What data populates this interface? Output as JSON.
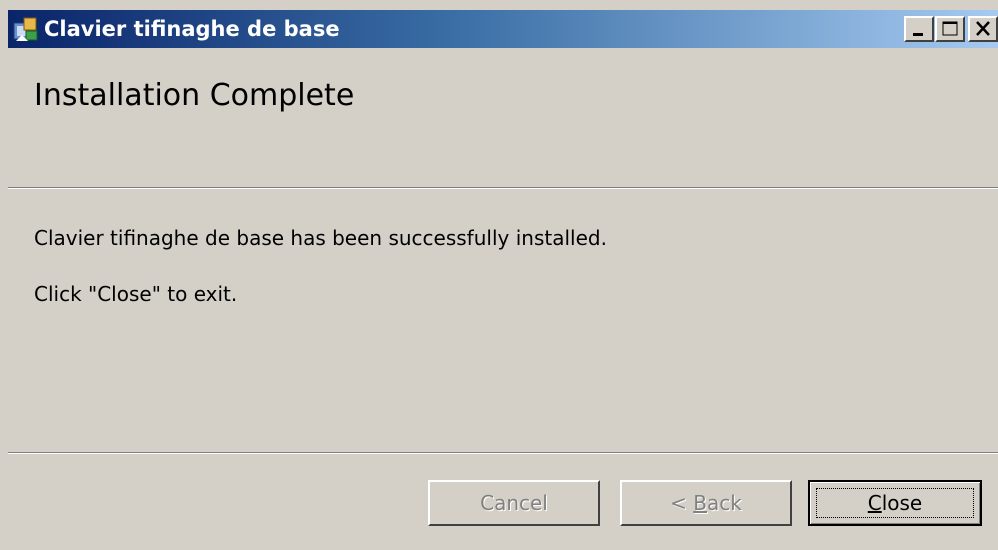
{
  "window": {
    "title": "Clavier tifinaghe de base",
    "controls": {
      "minimize_icon": "minimize-icon",
      "maximize_icon": "maximize-icon",
      "close_icon": "close-icon"
    }
  },
  "header": {
    "heading": "Installation Complete"
  },
  "body": {
    "message": "Clavier tifinaghe de base has been successfully installed.",
    "instruction": "Click \"Close\" to exit."
  },
  "buttons": {
    "cancel": {
      "label": "Cancel",
      "enabled": false
    },
    "back": {
      "prefix": "< ",
      "accel": "B",
      "rest": "ack",
      "enabled": false
    },
    "close": {
      "accel": "C",
      "rest": "lose",
      "enabled": true,
      "default": true
    }
  },
  "colors": {
    "face": "#d4d0c8",
    "title_start": "#0a246a",
    "title_end": "#a6caf0",
    "disabled_text": "#808080"
  }
}
